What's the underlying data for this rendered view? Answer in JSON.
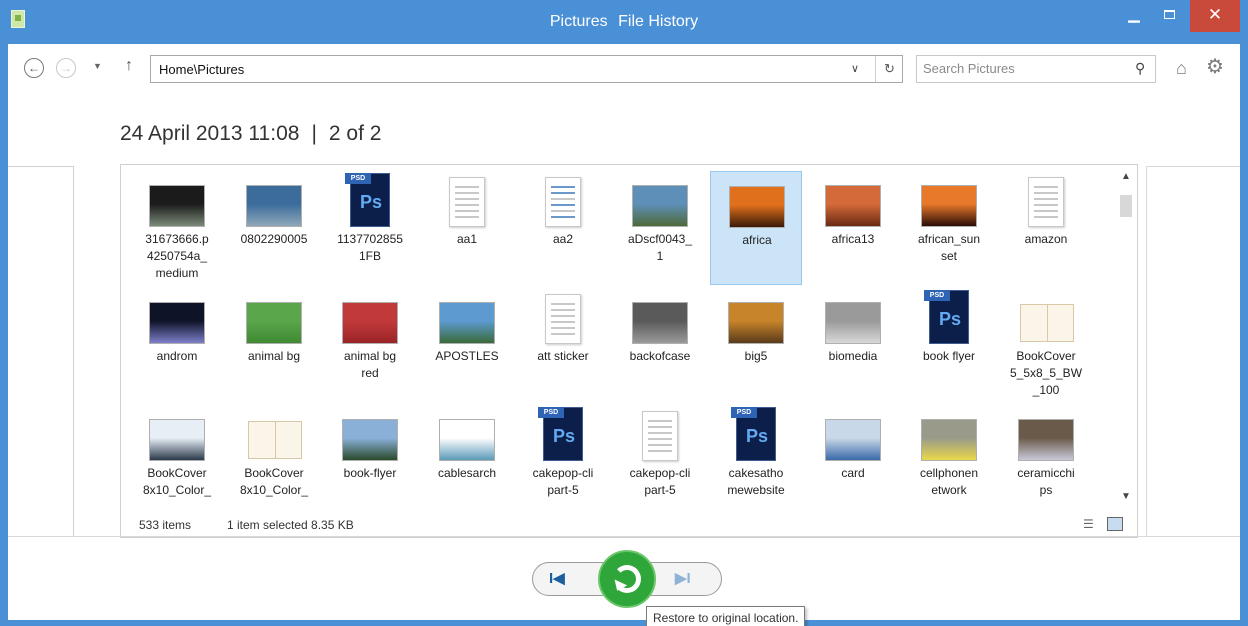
{
  "window": {
    "title_left": "Pictures",
    "title_right": "File History",
    "minimize_icon": "minimize-icon",
    "maximize_icon": "maximize-icon",
    "close_glyph": "✕"
  },
  "nav": {
    "back_glyph": "←",
    "forward_glyph": "→",
    "recent_glyph": "▼",
    "up_glyph": "↑",
    "address": "Home\\Pictures",
    "address_dropdown_glyph": "∨",
    "refresh_glyph": "↻",
    "search_placeholder": "Search Pictures",
    "search_glyph": "⚲",
    "home_glyph": "⌂",
    "gear_glyph": "⚙"
  },
  "heading": {
    "date": "24 April 2013 11:08",
    "separator": "|",
    "version": "2 of 2"
  },
  "files": [
    {
      "name": "31673666.p\n4250754a_\nmedium",
      "kind": "photo",
      "colors": [
        "#1b1b1b",
        "#7a8a78"
      ]
    },
    {
      "name": "0802290005",
      "kind": "photo",
      "colors": [
        "#3b6c9c",
        "#8fa8b8"
      ]
    },
    {
      "name": "1137702855\n1FB",
      "kind": "psd"
    },
    {
      "name": "aa1",
      "kind": "doc"
    },
    {
      "name": "aa2",
      "kind": "doc-blue"
    },
    {
      "name": "aDscf0043_\n1",
      "kind": "photo",
      "colors": [
        "#5d8fb8",
        "#4f6a3a"
      ]
    },
    {
      "name": "africa",
      "kind": "photo",
      "colors": [
        "#e0701c",
        "#3a1a08"
      ],
      "selected": true
    },
    {
      "name": "africa13",
      "kind": "photo",
      "colors": [
        "#d46a3a",
        "#6b2a12"
      ]
    },
    {
      "name": "african_sun\nset",
      "kind": "photo",
      "colors": [
        "#e8782a",
        "#2a0e08"
      ]
    },
    {
      "name": "amazon",
      "kind": "doc"
    },
    {
      "name": "androm",
      "kind": "photo",
      "colors": [
        "#0e1328",
        "#7d7ec9"
      ]
    },
    {
      "name": "animal bg",
      "kind": "photo",
      "colors": [
        "#5aa64a",
        "#3f8a34"
      ]
    },
    {
      "name": "animal bg\nred",
      "kind": "photo",
      "colors": [
        "#c2393a",
        "#9a2426"
      ]
    },
    {
      "name": "APOSTLES",
      "kind": "photo",
      "colors": [
        "#5d9ad0",
        "#3a6a3a"
      ]
    },
    {
      "name": "att sticker",
      "kind": "doc"
    },
    {
      "name": "backofcase",
      "kind": "photo",
      "colors": [
        "#5a5a5a",
        "#9a9a9a"
      ]
    },
    {
      "name": "big5",
      "kind": "photo",
      "colors": [
        "#c8842a",
        "#5a3a1a"
      ]
    },
    {
      "name": "biomedia",
      "kind": "photo",
      "colors": [
        "#9a9a9a",
        "#d8d8d8"
      ]
    },
    {
      "name": "book flyer",
      "kind": "psd"
    },
    {
      "name": "BookCover\n5_5x8_5_BW\n_100",
      "kind": "book"
    },
    {
      "name": "BookCover\n8x10_Color_",
      "kind": "photo",
      "colors": [
        "#e8eef6",
        "#2a3a4a"
      ]
    },
    {
      "name": "BookCover\n8x10_Color_",
      "kind": "book"
    },
    {
      "name": "book-flyer",
      "kind": "photo",
      "colors": [
        "#8ab0d8",
        "#2a4a2a"
      ]
    },
    {
      "name": "cablesarch",
      "kind": "photo",
      "colors": [
        "#ffffff",
        "#5a9ab8"
      ]
    },
    {
      "name": "cakepop-cli\npart-5",
      "kind": "psd"
    },
    {
      "name": "cakepop-cli\npart-5",
      "kind": "doc"
    },
    {
      "name": "cakesatho\nmewebsite",
      "kind": "psd"
    },
    {
      "name": "card",
      "kind": "photo",
      "colors": [
        "#c8d8e8",
        "#3a6aa8"
      ]
    },
    {
      "name": "cellphonen\network",
      "kind": "photo",
      "colors": [
        "#9a9a8a",
        "#e8d84a"
      ]
    },
    {
      "name": "ceramicchi\nps",
      "kind": "photo",
      "colors": [
        "#6a5a4a",
        "#c8c8d8"
      ]
    }
  ],
  "status": {
    "count": "533 items",
    "selection": "1 item selected  8.35 KB"
  },
  "playback": {
    "prev_glyph": "I◀",
    "next_glyph": "▶I",
    "tooltip": "Restore to original location."
  }
}
